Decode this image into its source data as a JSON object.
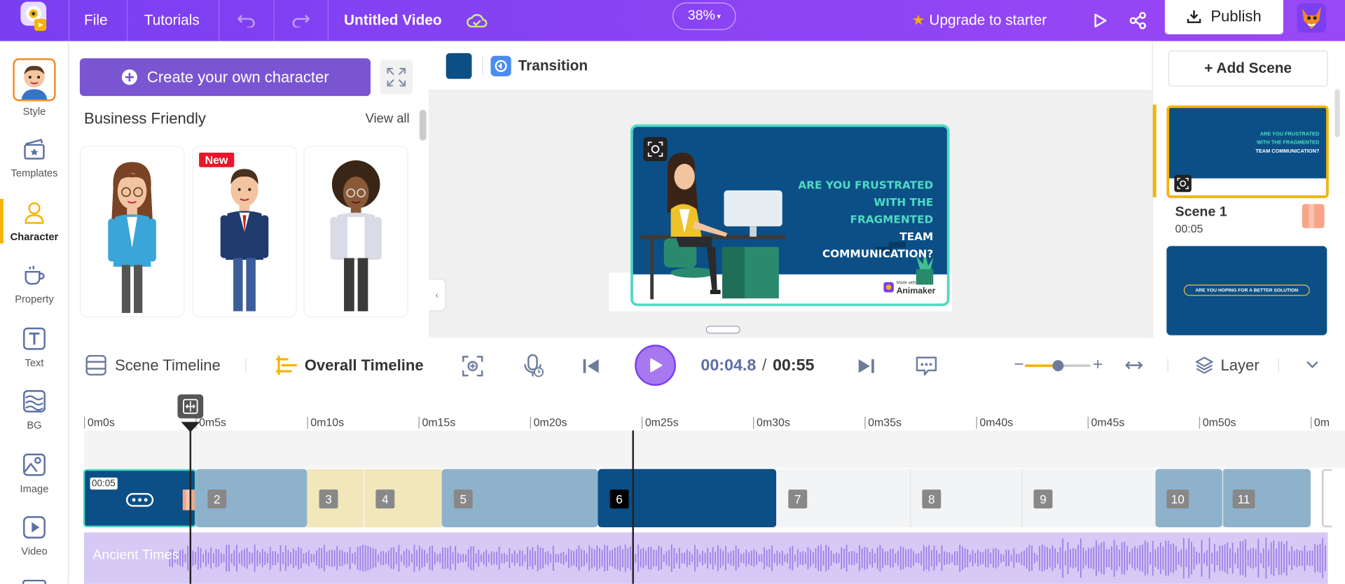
{
  "topbar": {
    "file": "File",
    "tutorials": "Tutorials",
    "title": "Untitled Video",
    "zoom": "38%",
    "upgrade": "Upgrade to starter",
    "publish": "Publish"
  },
  "rail": {
    "items": [
      {
        "label": "Style",
        "icon": "avatar-style-icon"
      },
      {
        "label": "Templates",
        "icon": "templates-icon"
      },
      {
        "label": "Character",
        "icon": "character-icon"
      },
      {
        "label": "Property",
        "icon": "property-icon"
      },
      {
        "label": "Text",
        "icon": "text-icon"
      },
      {
        "label": "BG",
        "icon": "bg-icon"
      },
      {
        "label": "Image",
        "icon": "image-icon"
      },
      {
        "label": "Video",
        "icon": "video-icon"
      }
    ]
  },
  "characters": {
    "create_label": "Create your own character",
    "section_title": "Business Friendly",
    "view_all": "View all",
    "new_badge": "New"
  },
  "canvas": {
    "transition_label": "Transition",
    "stage_text_1": "ARE YOU FRUSTRATED",
    "stage_text_2": "WITH THE FRAGMENTED",
    "stage_text_3": "TEAM COMMUNICATION?",
    "watermark_small": "Made with",
    "watermark": "Animaker"
  },
  "scenes": {
    "add_label": "+ Add Scene",
    "scene1_title": "Scene 1",
    "scene1_time": "00:05",
    "thumb1_line1": "ARE YOU FRUSTRATED",
    "thumb1_line2": "WITH THE FRAGMENTED",
    "thumb1_line3": "TEAM COMMUNICATION?",
    "thumb2_text": "ARE YOU HOPING FOR A BETTER SOLUTION"
  },
  "timeline": {
    "scene_timeline": "Scene Timeline",
    "overall_timeline": "Overall Timeline",
    "current_time": "00:04.8",
    "separator": "/",
    "total_time": "00:55",
    "layer": "Layer",
    "ruler": [
      "0m0s",
      "0m5s",
      "0m10s",
      "0m15s",
      "0m20s",
      "0m25s",
      "0m30s",
      "0m35s",
      "0m40s",
      "0m45s",
      "0m50s",
      "0m"
    ],
    "first_block_time": "00:05",
    "scene_numbers": [
      "2",
      "3",
      "4",
      "5",
      "6",
      "7",
      "8",
      "9",
      "10",
      "11"
    ],
    "audio_label": "Ancient Times"
  }
}
